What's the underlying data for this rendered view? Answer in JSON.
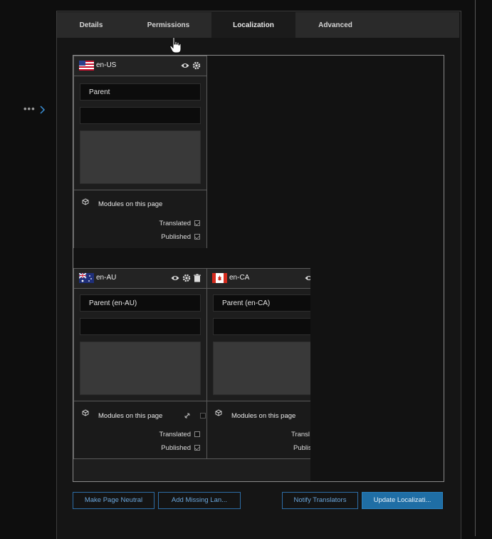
{
  "sidebar": {
    "more_label": "•••"
  },
  "tabs": [
    {
      "label": "Details"
    },
    {
      "label": "Permissions"
    },
    {
      "label": "Localization"
    },
    {
      "label": "Advanced"
    }
  ],
  "cards": {
    "en_us": {
      "lang": "en-US",
      "field_parent": "Parent",
      "modules_title": "Modules on this page",
      "translated_label": "Translated",
      "published_label": "Published"
    },
    "en_au": {
      "lang": "en-AU",
      "field_parent": "Parent (en-AU)",
      "modules_title": "Modules on this page",
      "translated_label": "Translated",
      "published_label": "Published"
    },
    "en_ca": {
      "lang": "en-CA",
      "field_parent": "Parent (en-CA)",
      "modules_title": "Modules on this page",
      "translated_label": "Transl",
      "published_label": "Publis"
    }
  },
  "buttons": {
    "make_neutral": "Make Page Neutral",
    "add_missing": "Add Missing Lan...",
    "notify": "Notify Translators",
    "update": "Update Localizati..."
  },
  "icons": {
    "more": "more-horizontal-icon",
    "expand": "chevron-right-icon",
    "view": "eye-icon",
    "settings": "gear-icon",
    "delete": "trash-icon",
    "link": "link-icon",
    "modules": "cube-icon"
  },
  "colors": {
    "accent": "#1f6ea5",
    "link_blue": "#6aa6dc",
    "background": "#0e0e0e"
  }
}
